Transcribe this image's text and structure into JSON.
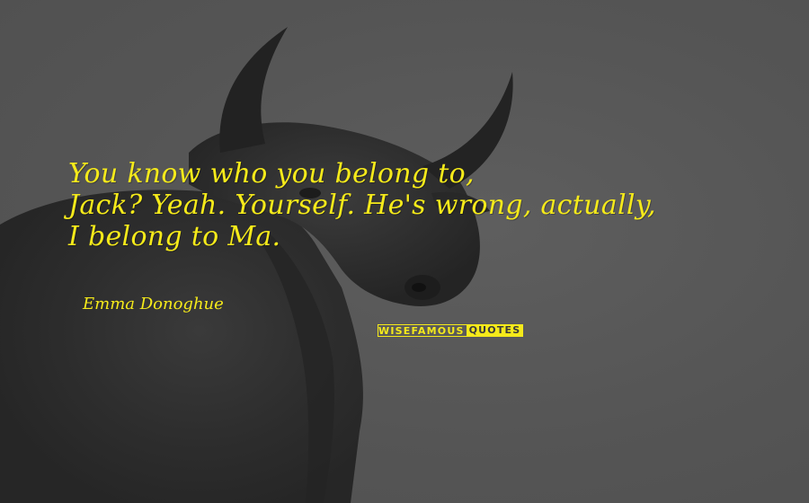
{
  "quote": {
    "lines": [
      "You know who you belong to,",
      "Jack? Yeah. Yourself. He's wrong, actually,",
      "I belong to Ma."
    ]
  },
  "author": "Emma Donoghue",
  "watermark": {
    "left": "WISEFAMOUS",
    "right": "QUOTES"
  },
  "colors": {
    "background": "#555555",
    "text": "#f5ea1a",
    "bull": "#2e2e2e"
  }
}
